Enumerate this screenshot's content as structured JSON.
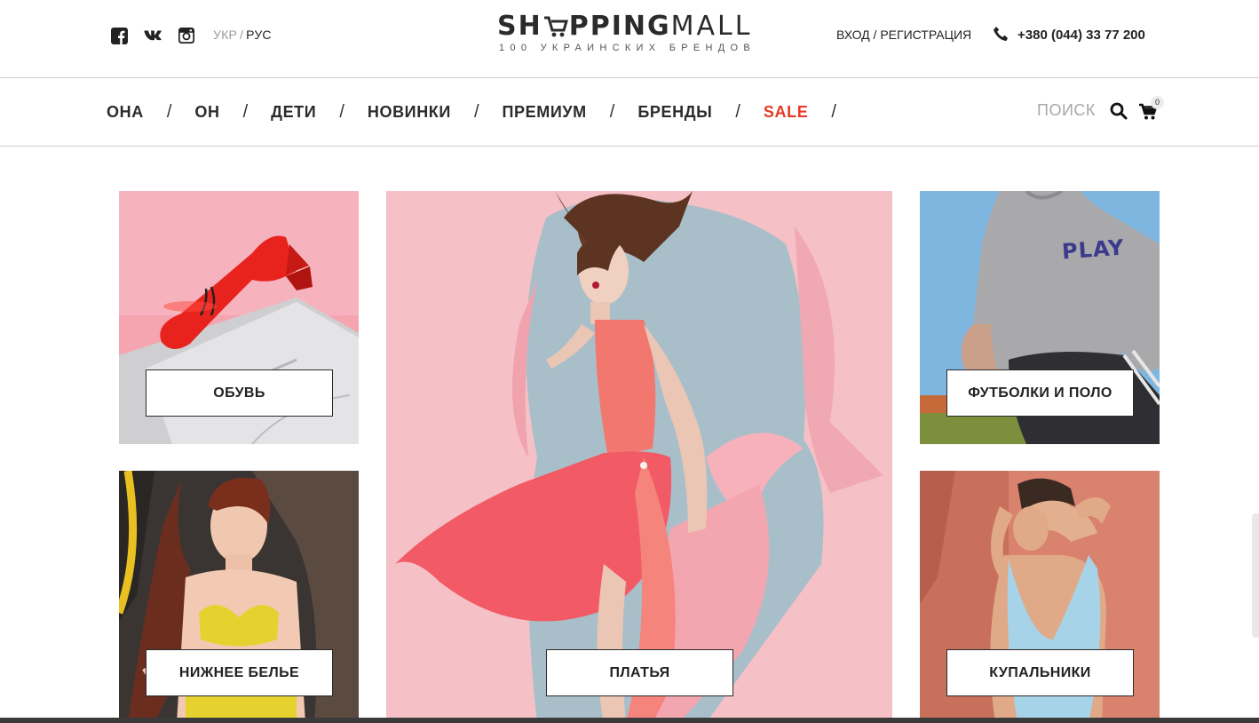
{
  "header": {
    "socials": [
      {
        "icon": "facebook-icon"
      },
      {
        "icon": "vk-icon"
      },
      {
        "icon": "instagram-icon"
      }
    ],
    "lang": {
      "ukr": "УКР",
      "separator": "/",
      "rus": "РУС"
    },
    "logo": {
      "part1": "SH",
      "part2": "PPING",
      "part3": "MALL",
      "tagline": "100 УКРАИНСКИХ БРЕНДОВ"
    },
    "auth": {
      "login": "ВХОД",
      "separator": " / ",
      "register": "РЕГИСТРАЦИЯ"
    },
    "phone": "+380 (044) 33 77 200"
  },
  "nav": {
    "items": [
      {
        "label": "ОНА"
      },
      {
        "label": "ОН"
      },
      {
        "label": "ДЕТИ"
      },
      {
        "label": "НОВИНКИ"
      },
      {
        "label": "ПРЕМИУМ"
      },
      {
        "label": "БРЕНДЫ"
      },
      {
        "label": "SALE"
      }
    ],
    "separator": "/",
    "search_placeholder": "ПОИСК",
    "cart_count": "0"
  },
  "tiles": {
    "shoes": "ОБУВЬ",
    "lingerie": "НИЖНЕЕ БЕЛЬЕ",
    "dresses": "ПЛАТЬЯ",
    "tshirts": "ФУТБОЛКИ И ПОЛО",
    "swim": "КУПАЛЬНИКИ",
    "tshirt_print": "PLAY"
  },
  "colors": {
    "accent_sale": "#e53a25",
    "text": "#222222",
    "muted": "#9a9a9a"
  }
}
